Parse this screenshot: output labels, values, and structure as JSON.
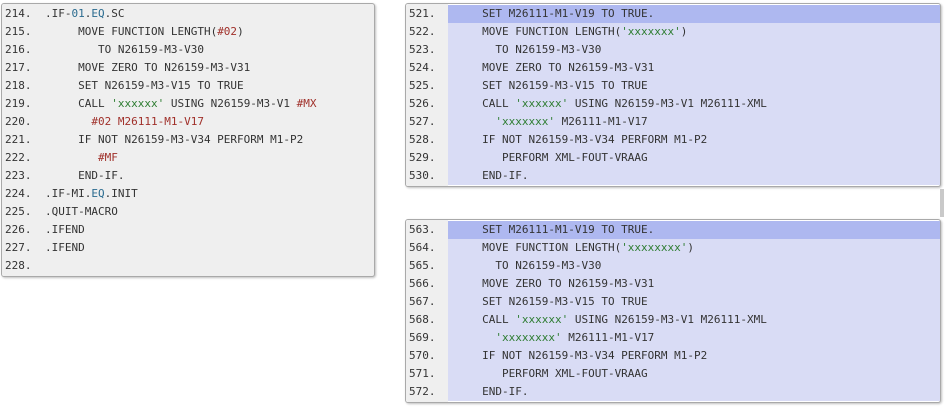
{
  "left_panel": {
    "lines": [
      {
        "n": "214.",
        "parts": [
          {
            "t": ".IF-",
            "c": "kw"
          },
          {
            "t": "01",
            "c": "num"
          },
          {
            "t": ".",
            "c": "kw"
          },
          {
            "t": "EQ",
            "c": "num"
          },
          {
            "t": ".SC",
            "c": "kw"
          }
        ]
      },
      {
        "n": "215.",
        "parts": [
          {
            "t": "     MOVE FUNCTION LENGTH(",
            "c": "kw"
          },
          {
            "t": "#02",
            "c": "mac"
          },
          {
            "t": ")",
            "c": "kw"
          }
        ]
      },
      {
        "n": "216.",
        "parts": [
          {
            "t": "        TO N26159-M3-V30",
            "c": "kw"
          }
        ]
      },
      {
        "n": "217.",
        "parts": [
          {
            "t": "     MOVE ZERO TO N26159-M3-V31",
            "c": "kw"
          }
        ]
      },
      {
        "n": "218.",
        "parts": [
          {
            "t": "     SET N26159-M3-V15 TO TRUE",
            "c": "kw"
          }
        ]
      },
      {
        "n": "219.",
        "parts": [
          {
            "t": "     CALL ",
            "c": "kw"
          },
          {
            "t": "'xxxxxx'",
            "c": "str"
          },
          {
            "t": " USING N26159-M3-V1 ",
            "c": "kw"
          },
          {
            "t": "#MX",
            "c": "mac"
          }
        ]
      },
      {
        "n": "220.",
        "parts": [
          {
            "t": "       ",
            "c": "kw"
          },
          {
            "t": "#02",
            "c": "mac"
          },
          {
            "t": " M26111-M1-V17",
            "c": "mac"
          }
        ]
      },
      {
        "n": "221.",
        "parts": [
          {
            "t": "     IF NOT N26159-M3-V34 PERFORM M1-P2",
            "c": "kw"
          }
        ]
      },
      {
        "n": "222.",
        "parts": [
          {
            "t": "        ",
            "c": "kw"
          },
          {
            "t": "#MF",
            "c": "mac"
          }
        ]
      },
      {
        "n": "223.",
        "parts": [
          {
            "t": "     END-IF.",
            "c": "kw"
          }
        ]
      },
      {
        "n": "224.",
        "parts": [
          {
            "t": ".IF-MI.",
            "c": "kw"
          },
          {
            "t": "EQ",
            "c": "num"
          },
          {
            "t": ".INIT",
            "c": "kw"
          }
        ]
      },
      {
        "n": "225.",
        "parts": [
          {
            "t": ".QUIT-MACRO",
            "c": "kw"
          }
        ]
      },
      {
        "n": "226.",
        "parts": [
          {
            "t": ".IFEND",
            "c": "kw"
          }
        ]
      },
      {
        "n": "227.",
        "parts": [
          {
            "t": ".IFEND",
            "c": "kw"
          }
        ]
      },
      {
        "n": "228.",
        "parts": [
          {
            "t": "",
            "c": "kw"
          }
        ]
      }
    ]
  },
  "right_top_panel": {
    "lines": [
      {
        "n": "521.",
        "parts": [
          {
            "t": "     SET M26111-M1-V19 TO TRUE.",
            "c": "kw"
          }
        ]
      },
      {
        "n": "522.",
        "parts": [
          {
            "t": "     MOVE FUNCTION LENGTH(",
            "c": "kw"
          },
          {
            "t": "'xxxxxxx'",
            "c": "str"
          },
          {
            "t": ")",
            "c": "kw"
          }
        ]
      },
      {
        "n": "523.",
        "parts": [
          {
            "t": "       TO N26159-M3-V30",
            "c": "kw"
          }
        ]
      },
      {
        "n": "524.",
        "parts": [
          {
            "t": "     MOVE ZERO TO N26159-M3-V31",
            "c": "kw"
          }
        ]
      },
      {
        "n": "525.",
        "parts": [
          {
            "t": "     SET N26159-M3-V15 TO TRUE",
            "c": "kw"
          }
        ]
      },
      {
        "n": "526.",
        "parts": [
          {
            "t": "     CALL ",
            "c": "kw"
          },
          {
            "t": "'xxxxxx'",
            "c": "str"
          },
          {
            "t": " USING N26159-M3-V1 M26111-XML",
            "c": "kw"
          }
        ]
      },
      {
        "n": "527.",
        "parts": [
          {
            "t": "       ",
            "c": "kw"
          },
          {
            "t": "'xxxxxxx'",
            "c": "str"
          },
          {
            "t": " M26111-M1-V17",
            "c": "kw"
          }
        ]
      },
      {
        "n": "528.",
        "parts": [
          {
            "t": "     IF NOT N26159-M3-V34 PERFORM M1-P2",
            "c": "kw"
          }
        ]
      },
      {
        "n": "529.",
        "parts": [
          {
            "t": "        PERFORM XML-FOUT-VRAAG",
            "c": "kw"
          }
        ]
      },
      {
        "n": "530.",
        "parts": [
          {
            "t": "     END-IF.",
            "c": "kw"
          }
        ]
      }
    ]
  },
  "right_bottom_panel": {
    "lines": [
      {
        "n": "563.",
        "parts": [
          {
            "t": "     SET M26111-M1-V19 TO TRUE.",
            "c": "kw"
          }
        ]
      },
      {
        "n": "564.",
        "parts": [
          {
            "t": "     MOVE FUNCTION LENGTH(",
            "c": "kw"
          },
          {
            "t": "'xxxxxxxx'",
            "c": "str"
          },
          {
            "t": ")",
            "c": "kw"
          }
        ]
      },
      {
        "n": "565.",
        "parts": [
          {
            "t": "       TO N26159-M3-V30",
            "c": "kw"
          }
        ]
      },
      {
        "n": "566.",
        "parts": [
          {
            "t": "     MOVE ZERO TO N26159-M3-V31",
            "c": "kw"
          }
        ]
      },
      {
        "n": "567.",
        "parts": [
          {
            "t": "     SET N26159-M3-V15 TO TRUE",
            "c": "kw"
          }
        ]
      },
      {
        "n": "568.",
        "parts": [
          {
            "t": "     CALL ",
            "c": "kw"
          },
          {
            "t": "'xxxxxx'",
            "c": "str"
          },
          {
            "t": " USING N26159-M3-V1 M26111-XML",
            "c": "kw"
          }
        ]
      },
      {
        "n": "569.",
        "parts": [
          {
            "t": "       ",
            "c": "kw"
          },
          {
            "t": "'xxxxxxxx'",
            "c": "str"
          },
          {
            "t": " M26111-M1-V17",
            "c": "kw"
          }
        ]
      },
      {
        "n": "570.",
        "parts": [
          {
            "t": "     IF NOT N26159-M3-V34 PERFORM M1-P2",
            "c": "kw"
          }
        ]
      },
      {
        "n": "571.",
        "parts": [
          {
            "t": "        PERFORM XML-FOUT-VRAAG",
            "c": "kw"
          }
        ]
      },
      {
        "n": "572.",
        "parts": [
          {
            "t": "     END-IF.",
            "c": "kw"
          }
        ]
      }
    ]
  },
  "colors": {
    "highlight_line": "#aeb8f0",
    "highlight_block": "#d9dcf5",
    "gutter": "#efefef",
    "string": "#2e7d32",
    "macro": "#a0302a",
    "keyword_num": "#2a6b8f"
  }
}
